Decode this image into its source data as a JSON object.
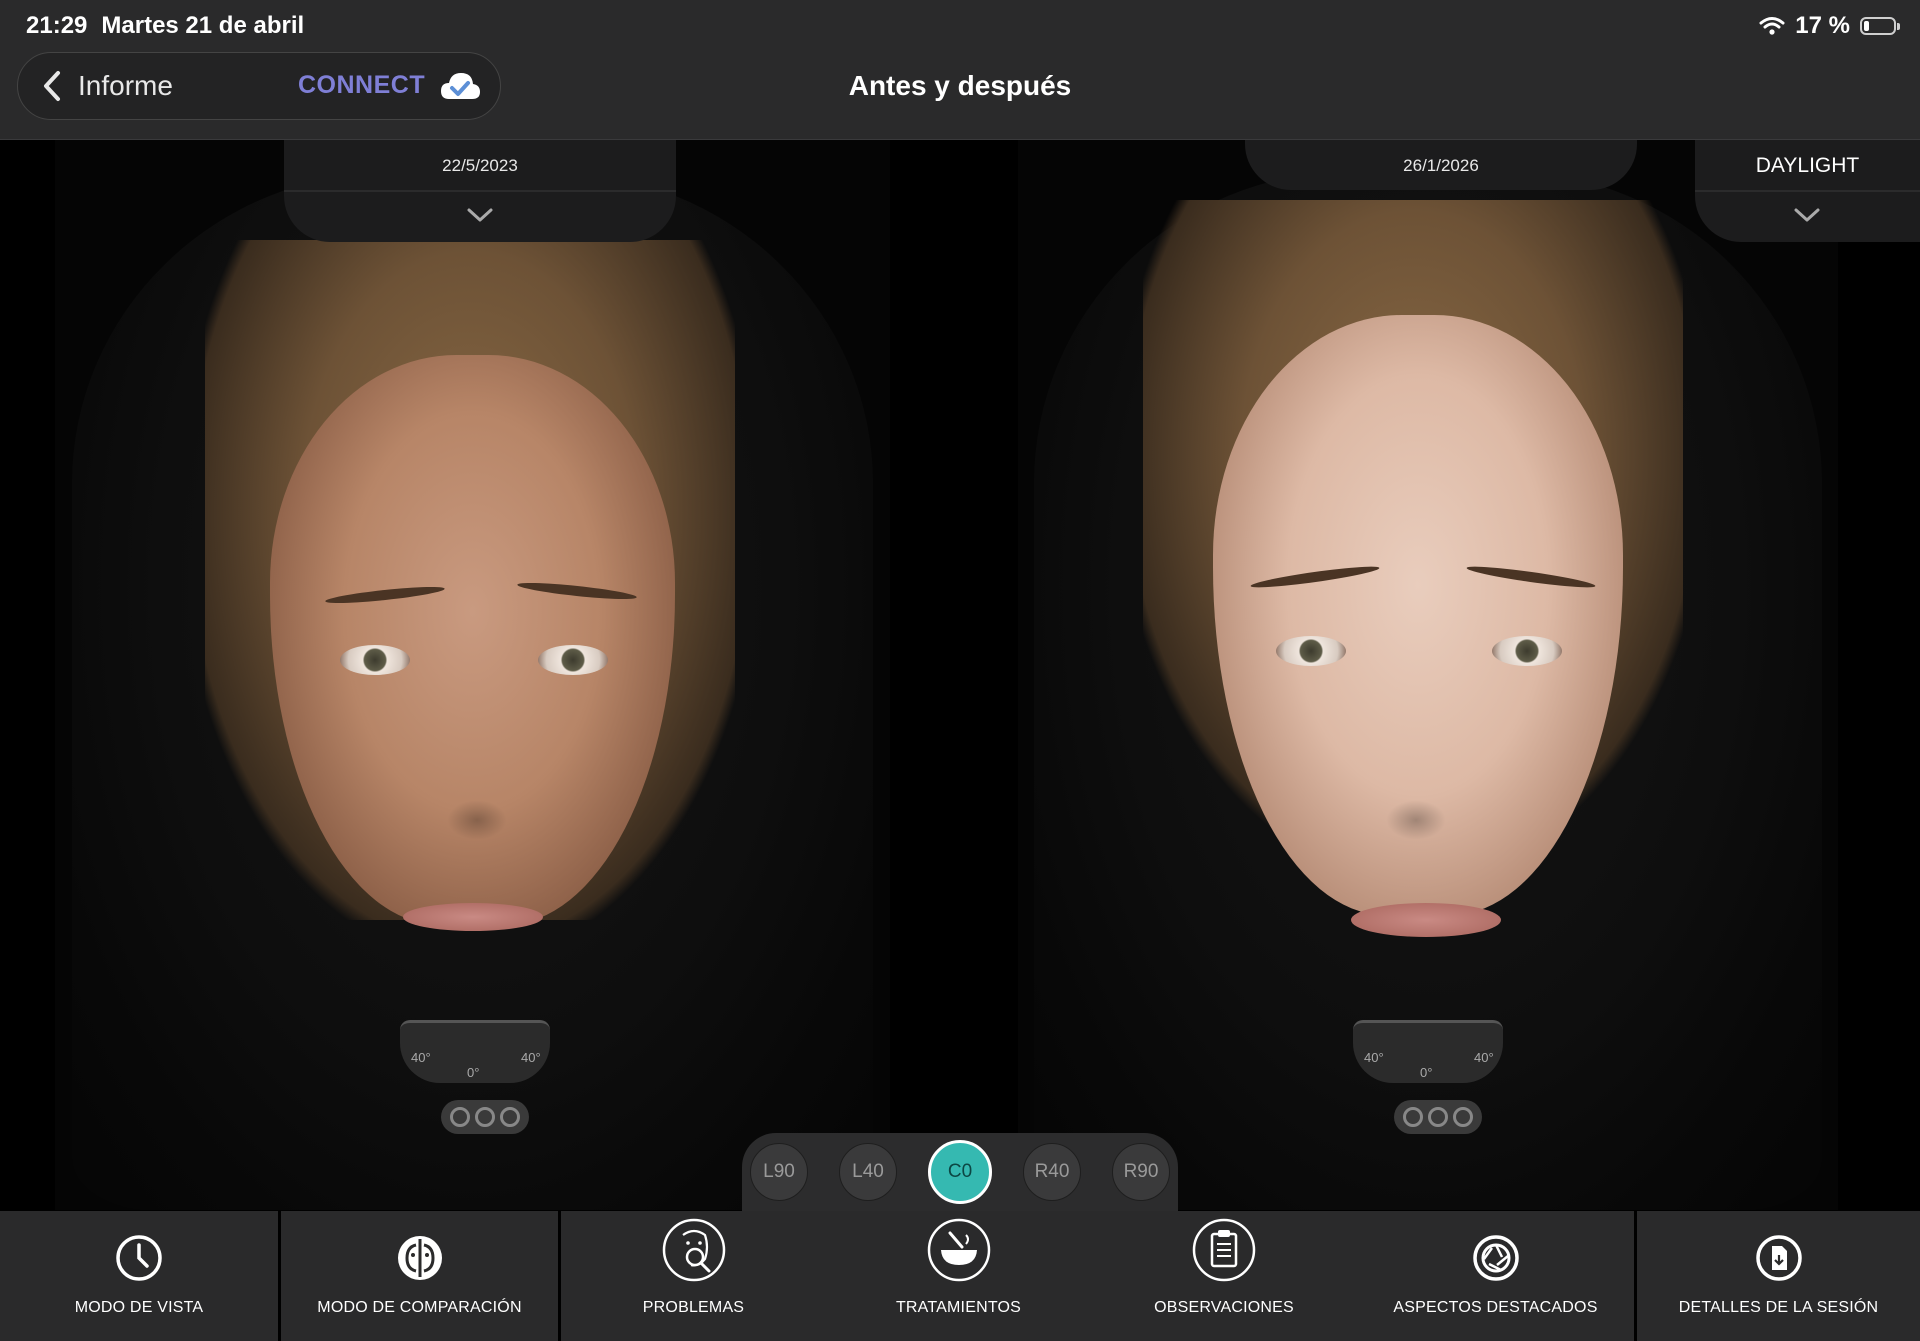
{
  "status_bar": {
    "time": "21:29",
    "date": "Martes 21 de abril",
    "battery": "17 %",
    "battery_level": 0.17
  },
  "nav": {
    "back_label": "Informe",
    "connect_label": "CONNECT",
    "title": "Antes y después"
  },
  "comparison": {
    "left_date": "22/5/2023",
    "right_date": "26/1/2026",
    "lighting_mode": "DAYLIGHT"
  },
  "angle_selector": {
    "options": [
      "L90",
      "L40",
      "C0",
      "R40",
      "R90"
    ],
    "selected": "C0"
  },
  "toolbar": {
    "items": [
      {
        "label": "MODO DE VISTA",
        "icon": "clock-icon"
      },
      {
        "label": "MODO DE COMPARACIÓN",
        "icon": "compare-faces-icon"
      },
      {
        "label": "PROBLEMAS",
        "icon": "face-magnify-icon"
      },
      {
        "label": "TRATAMIENTOS",
        "icon": "bowl-treatment-icon"
      },
      {
        "label": "OBSERVACIONES",
        "icon": "clipboard-icon"
      },
      {
        "label": "ASPECTOS DESTACADOS",
        "icon": "aperture-icon"
      },
      {
        "label": "DETALLES DE LA SESIÓN",
        "icon": "document-icon"
      }
    ]
  },
  "colors": {
    "accent_teal": "#35b9b1",
    "connect_purple": "#7f7fd6",
    "bar_bg": "#2a2a2b"
  }
}
